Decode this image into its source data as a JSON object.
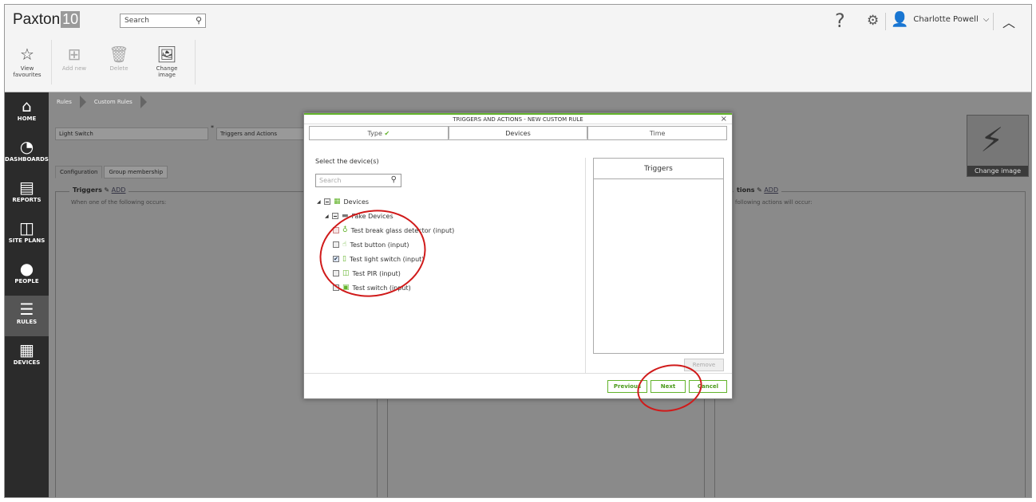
{
  "header": {
    "logo_text": "Paxton",
    "logo_badge": "10",
    "search_placeholder": "Search",
    "help": "?",
    "user_name": "Charlotte Powell",
    "user_caret": "⌵",
    "collapse": "︿"
  },
  "toolbar": {
    "view_favourites": "View favourites",
    "add_new": "Add new",
    "delete": "Delete",
    "change_image": "Change image"
  },
  "sidebar": {
    "items": [
      {
        "label": "HOME",
        "icon": "home-icon"
      },
      {
        "label": "DASHBOARDS",
        "icon": "gauge-icon"
      },
      {
        "label": "REPORTS",
        "icon": "report-icon"
      },
      {
        "label": "SITE PLANS",
        "icon": "map-icon"
      },
      {
        "label": "PEOPLE",
        "icon": "person-icon"
      },
      {
        "label": "RULES",
        "icon": "rules-icon"
      },
      {
        "label": "DEVICES",
        "icon": "devices-icon"
      }
    ]
  },
  "breadcrumb": {
    "item1": "Rules",
    "item2": "Custom Rules"
  },
  "form": {
    "name_value": "Light Switch",
    "required_mark": "*",
    "rule_type": "Triggers and Actions"
  },
  "tabs": {
    "configuration": "Configuration",
    "group_membership": "Group membership"
  },
  "panels": {
    "triggers_title": "Triggers",
    "triggers_add": "ADD",
    "triggers_sub": "When one of the following occurs:",
    "actions_title": "tions",
    "actions_add": "ADD",
    "actions_sub": "following actions will occur:"
  },
  "change_image_label": "Change image",
  "modal": {
    "title": "TRIGGERS AND ACTIONS - NEW CUSTOM RULE",
    "close": "×",
    "tab_type": "Type",
    "tab_devices": "Devices",
    "tab_time": "Time",
    "select_label": "Select the device(s)",
    "search_placeholder": "Search",
    "tree": {
      "root": "Devices",
      "group": "Fake Devices",
      "items": [
        {
          "label": "Test break glass detector (input)",
          "state": "disabled"
        },
        {
          "label": "Test button (input)",
          "state": "unchecked"
        },
        {
          "label": "Test light switch (input)",
          "state": "checked"
        },
        {
          "label": "Test PIR (input)",
          "state": "unchecked"
        },
        {
          "label": "Test switch (input)",
          "state": "unchecked"
        }
      ]
    },
    "triggers_header": "Triggers",
    "remove": "Remove",
    "previous": "Previous",
    "next": "Next",
    "cancel": "Cancel"
  },
  "colors": {
    "accent": "#62b32a",
    "annotation": "#d01a1a"
  }
}
